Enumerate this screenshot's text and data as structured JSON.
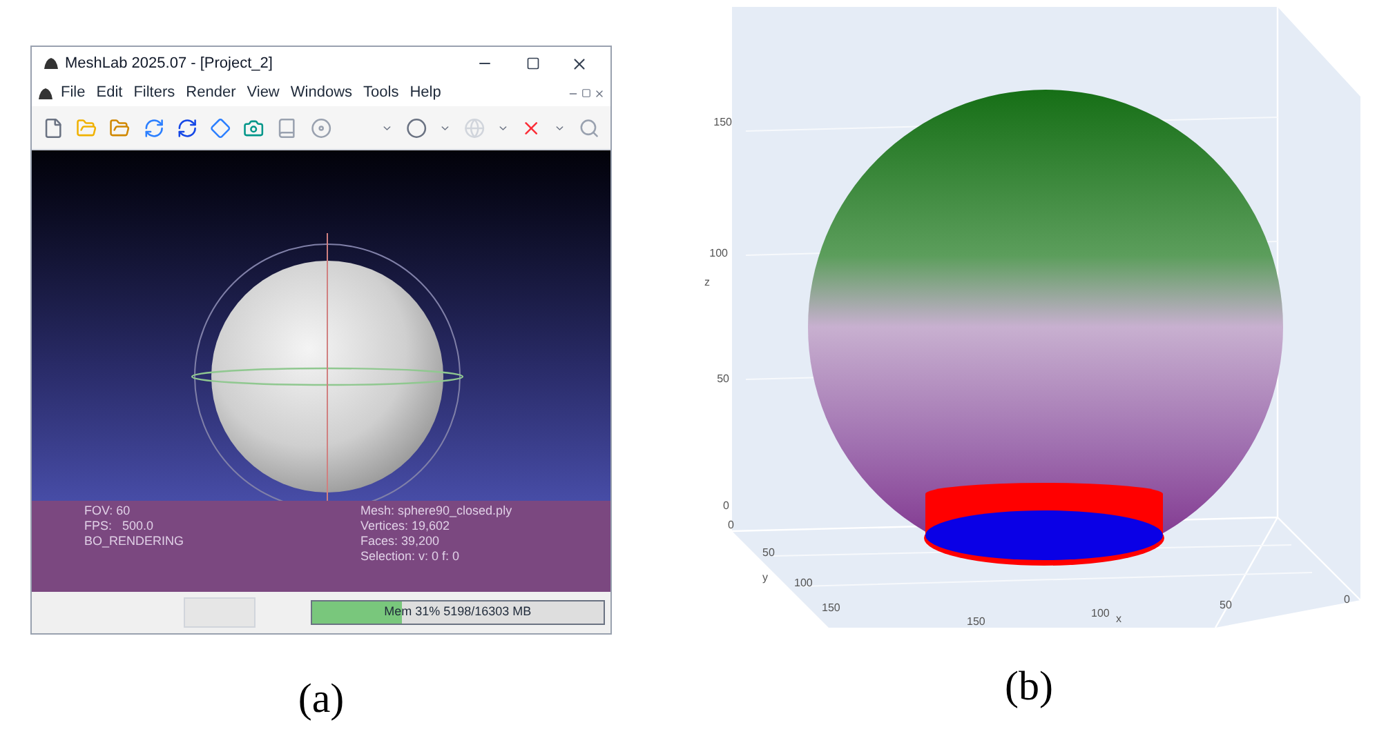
{
  "window": {
    "title": "MeshLab 2025.07 - [Project_2]"
  },
  "menu": [
    {
      "label": "File"
    },
    {
      "label": "Edit"
    },
    {
      "label": "Filters"
    },
    {
      "label": "Render"
    },
    {
      "label": "View"
    },
    {
      "label": "Windows"
    },
    {
      "label": "Tools"
    },
    {
      "label": "Help"
    }
  ],
  "viewport": {
    "info_left": [
      "FOV: 60",
      "FPS:   500.0",
      "BO_RENDERING"
    ],
    "info_right": [
      "Mesh: sphere90_closed.ply",
      "Vertices: 19,602",
      "Faces: 39,200",
      "Selection: v: 0 f: 0"
    ]
  },
  "status_bar": {
    "memory": {
      "label": "Mem 31% 5198/16303 MB",
      "level": 0.31
    }
  },
  "caption_a": "(a)",
  "plot": {
    "z_ticks": [
      "150",
      "100",
      "50",
      "0"
    ],
    "z_label": "z",
    "y_ticks": [
      "0",
      "50",
      "100",
      "150"
    ],
    "y_label": "y",
    "x_ticks": [
      "150",
      "100",
      "50",
      "0"
    ],
    "x_label": "x",
    "caption": "(b)"
  }
}
